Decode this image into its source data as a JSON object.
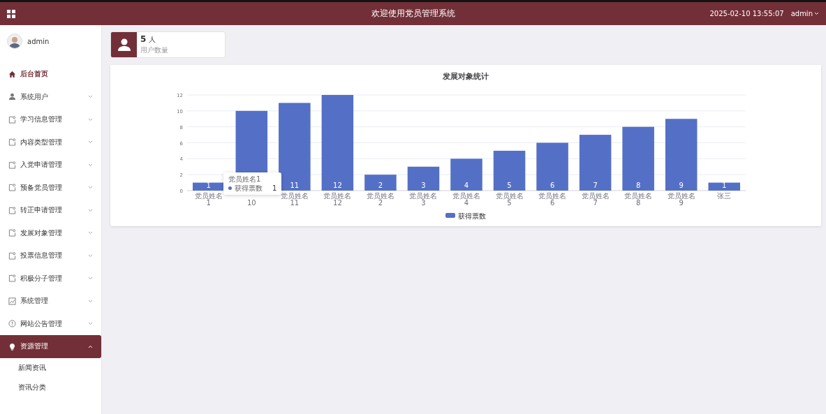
{
  "header": {
    "title": "欢迎使用党员管理系统",
    "datetime": "2025-02-10 13:55:07",
    "user": "admin"
  },
  "sidebar": {
    "user": "admin",
    "items": [
      {
        "label": "后台首页",
        "kind": "link",
        "selected": true
      },
      {
        "label": "系统用户",
        "kind": "menu",
        "selected": false,
        "expanded": false
      },
      {
        "label": "学习信息管理",
        "kind": "menu",
        "selected": false,
        "expanded": false
      },
      {
        "label": "内容类型管理",
        "kind": "menu",
        "selected": false,
        "expanded": false
      },
      {
        "label": "入党申请管理",
        "kind": "menu",
        "selected": false,
        "expanded": false
      },
      {
        "label": "预备党员管理",
        "kind": "menu",
        "selected": false,
        "expanded": false
      },
      {
        "label": "转正申请管理",
        "kind": "menu",
        "selected": false,
        "expanded": false
      },
      {
        "label": "发展对象管理",
        "kind": "menu",
        "selected": false,
        "expanded": false
      },
      {
        "label": "投票信息管理",
        "kind": "menu",
        "selected": false,
        "expanded": false
      },
      {
        "label": "积极分子管理",
        "kind": "menu",
        "selected": false,
        "expanded": false
      },
      {
        "label": "系统管理",
        "kind": "menu",
        "selected": false,
        "expanded": false
      },
      {
        "label": "网站公告管理",
        "kind": "menu",
        "selected": false,
        "expanded": false
      },
      {
        "label": "资源管理",
        "kind": "menu",
        "selected": false,
        "expanded": true,
        "children": [
          {
            "label": "新闻资讯"
          },
          {
            "label": "资讯分类"
          }
        ]
      }
    ]
  },
  "stat": {
    "value": "5",
    "unit": "人",
    "label": "用户数量"
  },
  "chart": {
    "chart_data": {
      "type": "bar",
      "title": "发展对象统计",
      "categories": [
        "党员姓名\n1",
        "\n10",
        "党员姓名\n11",
        "党员姓名\n12",
        "党员姓名\n2",
        "党员姓名\n3",
        "党员姓名\n4",
        "党员姓名\n5",
        "党员姓名\n6",
        "党员姓名\n7",
        "党员姓名\n8",
        "党员姓名\n9",
        "张三"
      ],
      "series": [
        {
          "name": "获得票数",
          "color": "#5470c6",
          "values": [
            1,
            10,
            11,
            12,
            2,
            3,
            4,
            5,
            6,
            7,
            8,
            9,
            1
          ]
        }
      ],
      "ylim": [
        0,
        12
      ],
      "yticks": [
        0,
        2,
        4,
        6,
        8,
        10,
        12
      ],
      "grid": true,
      "value_labels": [
        "1",
        null,
        "11",
        "12",
        "2",
        "3",
        "4",
        "5",
        "6",
        "7",
        "8",
        "9",
        "1"
      ]
    },
    "tooltip": {
      "title": "党员姓名1",
      "series": "获得票数",
      "value": "1"
    }
  }
}
